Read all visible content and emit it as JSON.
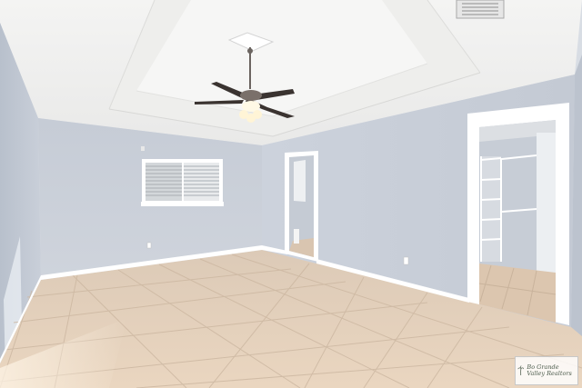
{
  "scene": {
    "subject": "empty bedroom with tray ceiling, ceiling fan, tiled floor, window, doorway and walk-in closet",
    "wall_color": "#cdd3dc",
    "floor_color": "#e6d0b8",
    "ceiling_color": "#f2f1ef",
    "trim_color": "#ffffff"
  },
  "watermark": {
    "text": "Bo Grande Valley Realtors",
    "icon": "palm-tree-icon"
  }
}
